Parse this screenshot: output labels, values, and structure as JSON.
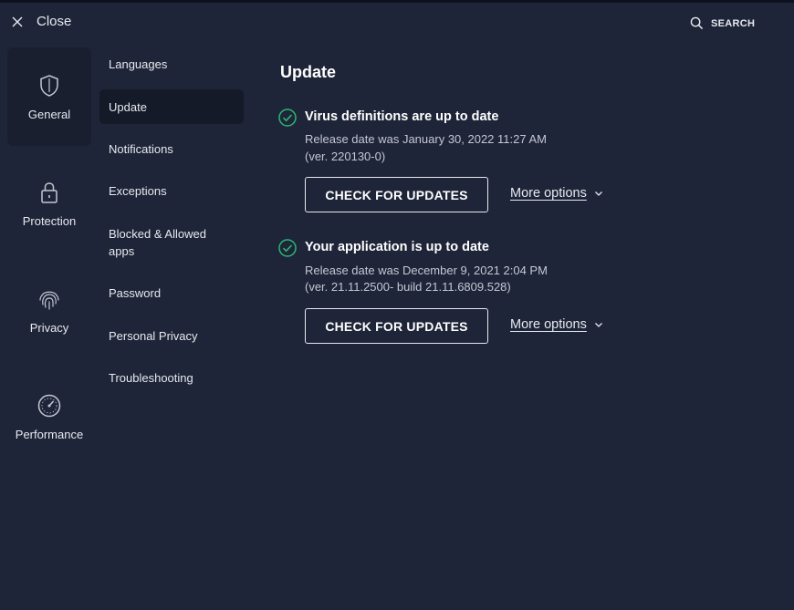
{
  "topbar": {
    "close_label": "Close",
    "close_icon": "close-icon",
    "search_label": "SEARCH",
    "search_icon": "search-icon"
  },
  "categories": [
    {
      "label": "General",
      "icon": "shield-icon",
      "active": true
    },
    {
      "label": "Protection",
      "icon": "lock-icon",
      "active": false
    },
    {
      "label": "Privacy",
      "icon": "fingerprint-icon",
      "active": false
    },
    {
      "label": "Performance",
      "icon": "speedometer-icon",
      "active": false
    }
  ],
  "subnav": [
    {
      "label": "Languages",
      "active": false
    },
    {
      "label": "Update",
      "active": true
    },
    {
      "label": "Notifications",
      "active": false
    },
    {
      "label": "Exceptions",
      "active": false
    },
    {
      "label": "Blocked & Allowed apps",
      "active": false
    },
    {
      "label": "Password",
      "active": false
    },
    {
      "label": "Personal Privacy",
      "active": false
    },
    {
      "label": "Troubleshooting",
      "active": false
    }
  ],
  "main": {
    "title": "Update",
    "sections": [
      {
        "status": "Virus definitions are up to date",
        "release": "Release date was January 30, 2022 11:27 AM",
        "version": "(ver. 220130-0)",
        "button_label": "CHECK FOR UPDATES",
        "more_label": "More options"
      },
      {
        "status": "Your application is up to date",
        "release": "Release date was December 9, 2021 2:04 PM",
        "version": "(ver. 21.11.2500- build 21.11.6809.528)",
        "button_label": "CHECK FOR UPDATES",
        "more_label": "More options"
      }
    ]
  },
  "colors": {
    "background": "#1f2538",
    "active_category": "#1a1f30",
    "active_subnav": "#151a29",
    "success_green": "#2bb673"
  }
}
